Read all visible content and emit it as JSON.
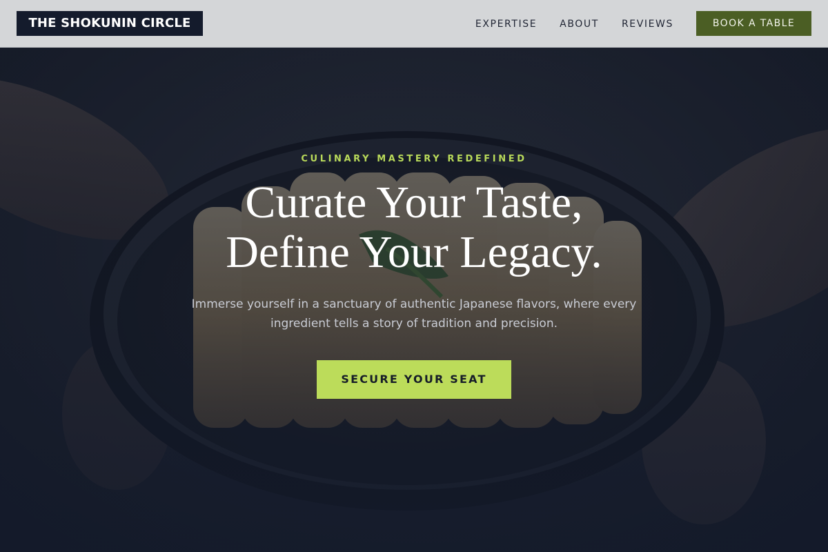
{
  "brand": {
    "name": "THE SHOKUNIN CIRCLE"
  },
  "nav": {
    "links": [
      {
        "label": "EXPERTISE"
      },
      {
        "label": "ABOUT"
      },
      {
        "label": "REVIEWS"
      }
    ],
    "cta_label": "BOOK A TABLE"
  },
  "hero": {
    "eyebrow": "CULINARY MASTERY REDEFINED",
    "headline_line1": "Curate Your Taste,",
    "headline_line2": "Define Your Legacy.",
    "subtext": "Immerse yourself in a sanctuary of authentic Japanese flavors, where every ingredient tells a story of tradition and precision.",
    "cta_label": "SECURE YOUR SEAT"
  },
  "colors": {
    "navy": "#141b2c",
    "olive": "#4b5e24",
    "lime": "#bcdc5a",
    "navbar_bg": "#dedfe2"
  }
}
